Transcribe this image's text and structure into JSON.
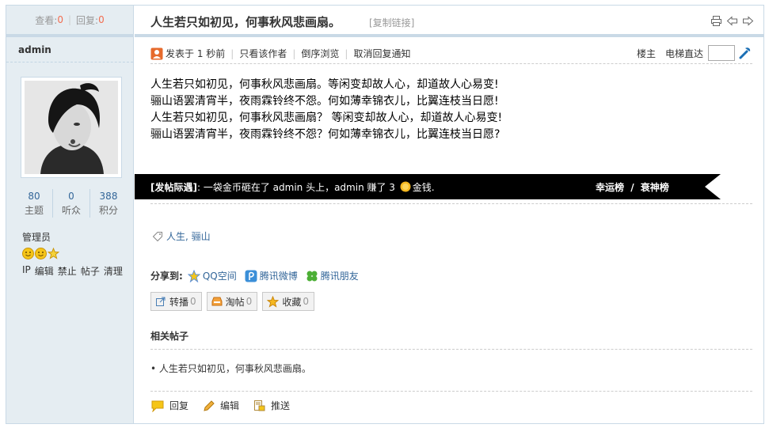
{
  "sidebar": {
    "views_label": "查看:",
    "views": "0",
    "replies_label": "回复:",
    "replies": "0",
    "author": "admin",
    "stats": [
      {
        "value": "80",
        "label": "主题"
      },
      {
        "value": "0",
        "label": "听众"
      },
      {
        "value": "388",
        "label": "积分"
      }
    ],
    "role": "管理员",
    "admin_links": [
      "IP",
      "编辑",
      "禁止",
      "帖子",
      "清理"
    ]
  },
  "thread": {
    "title": "人生若只如初见，何事秋风悲画扇。",
    "copy_link": "[复制链接]",
    "icons": [
      "print-icon",
      "prev-thread-icon",
      "next-thread-icon"
    ]
  },
  "meta": {
    "posted": "发表于 1 秒前",
    "only_author": "只看该作者",
    "reverse": "倒序浏览",
    "cancel_notify": "取消回复通知",
    "floor": "楼主",
    "elevator": "电梯直达"
  },
  "content": {
    "lines": [
      "人生若只如初见，何事秋风悲画扇。等闲变却故人心，却道故人心易变!",
      "骊山语罢清宵半，夜雨霖铃终不怨。何如薄幸锦衣儿，比翼连枝当日愿!",
      "人生若只如初见，何事秋风悲画扇？ 等闲变却故人心，却道故人心易变!",
      "骊山语罢清宵半，夜雨霖铃终不怨？何如薄幸锦衣儿，比翼连枝当日愿?"
    ]
  },
  "reward": {
    "prefix": "[发帖际遇]",
    "text": ": 一袋金币砸在了 admin 头上，admin 赚了 3",
    "currency": "金钱.",
    "lucky": "幸运榜",
    "sep": "/",
    "unlucky": "衰神榜"
  },
  "tags": {
    "items": "人生, 骊山"
  },
  "share": {
    "label": "分享到:",
    "qzone": "QQ空间",
    "weibo": "腾讯微博",
    "friends": "腾讯朋友"
  },
  "actions": [
    {
      "label": "转播",
      "count": "0"
    },
    {
      "label": "淘帖",
      "count": "0"
    },
    {
      "label": "收藏",
      "count": "0"
    }
  ],
  "related": {
    "title": "相关帖子",
    "items": [
      "• 人生若只如初见，何事秋风悲画扇。"
    ]
  },
  "footer": {
    "reply": "回复",
    "edit": "编辑",
    "push": "推送"
  }
}
